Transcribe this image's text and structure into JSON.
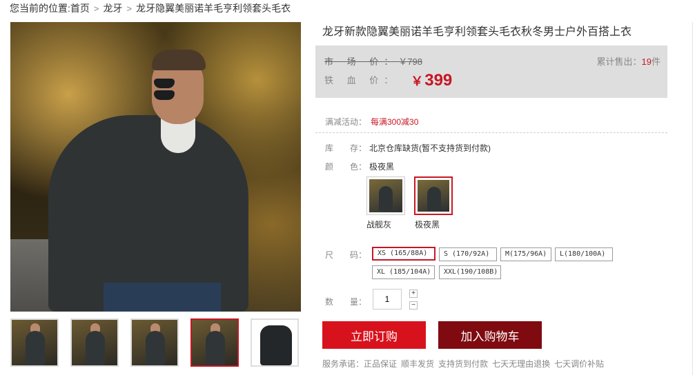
{
  "breadcrumb": {
    "prefix": "您当前的位置:",
    "items": [
      "首页",
      "龙牙",
      "龙牙隐翼美丽诺羊毛亨利领套头毛衣"
    ]
  },
  "product": {
    "title": "龙牙新款隐翼美丽诺羊毛亨利领套头毛衣秋冬男士户外百搭上衣"
  },
  "price_box": {
    "market_label": "市 场 价：",
    "market_price": "￥798",
    "sold_label": "累计售出：",
    "sold_count": "19",
    "sold_unit": "件",
    "iron_label": "铁 血 价：",
    "currency": "￥",
    "iron_price": "399"
  },
  "promo": {
    "label": "满减活动：",
    "value": "每满300减30"
  },
  "stock": {
    "label": "库　　存：",
    "value": "北京仓库缺货(暂不支持货到付款)"
  },
  "color": {
    "label": "颜　　色：",
    "selected": "极夜黑",
    "options": [
      "战舰灰",
      "极夜黑"
    ]
  },
  "size": {
    "label": "尺　　码：",
    "options": [
      "XS (165/88A)",
      "S (170/92A)",
      "M(175/96A)",
      "L(180/100A)",
      "XL (185/104A)",
      "XXL(190/108B)"
    ],
    "selected": "XS (165/88A)"
  },
  "quantity": {
    "label": "数　　量：",
    "value": "1",
    "plus": "+",
    "minus": "−"
  },
  "buttons": {
    "buy_now": "立即订购",
    "add_cart": "加入购物车"
  },
  "service": {
    "label": "服务承诺：",
    "items": [
      "正品保证",
      "顺丰发货",
      "支持货到付款",
      "七天无理由退换",
      "七天调价补贴"
    ]
  },
  "colors": {
    "accent": "#c81623",
    "buy_button": "#d8121c",
    "cart_button": "#7f0a10",
    "price_box_bg": "#dedede"
  }
}
